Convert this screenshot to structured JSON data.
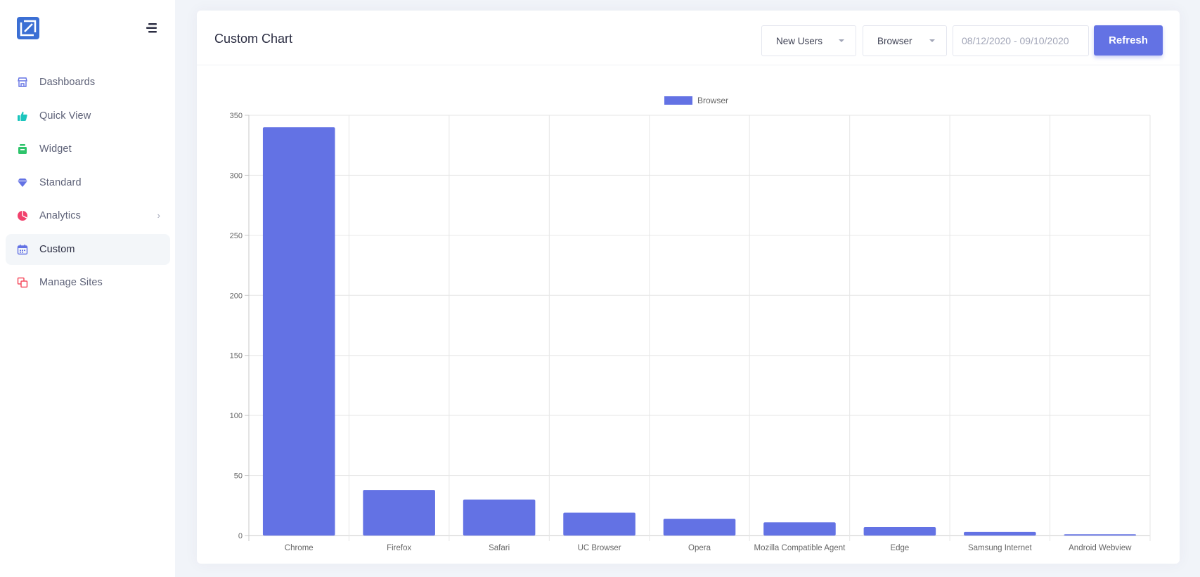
{
  "sidebar": {
    "items": [
      {
        "label": "Dashboards",
        "icon": "store-icon",
        "color": "#6372e4"
      },
      {
        "label": "Quick View",
        "icon": "thumb-icon",
        "color": "#1bc5bd"
      },
      {
        "label": "Widget",
        "icon": "box-icon",
        "color": "#2ec46b"
      },
      {
        "label": "Standard",
        "icon": "diamond-icon",
        "color": "#6372e4"
      },
      {
        "label": "Analytics",
        "icon": "pie-chart-icon",
        "color": "#f1416c",
        "has_submenu": true
      },
      {
        "label": "Custom",
        "icon": "calendar-icon",
        "color": "#6372e4",
        "active": true
      },
      {
        "label": "Manage Sites",
        "icon": "layers-icon",
        "color": "#f64e60"
      }
    ]
  },
  "card": {
    "title": "Custom Chart",
    "metric_select": "New Users",
    "dimension_select": "Browser",
    "date_range": "08/12/2020 - 09/10/2020",
    "refresh_label": "Refresh"
  },
  "chart_data": {
    "type": "bar",
    "categories": [
      "Chrome",
      "Firefox",
      "Safari",
      "UC Browser",
      "Opera",
      "Mozilla Compatible Agent",
      "Edge",
      "Samsung Internet",
      "Android Webview"
    ],
    "series": [
      {
        "name": "Browser",
        "values": [
          340,
          38,
          30,
          19,
          14,
          11,
          7,
          3,
          1
        ],
        "color": "#6372e4"
      }
    ],
    "ylim": [
      0,
      350
    ],
    "yticks": [
      0,
      50,
      100,
      150,
      200,
      250,
      300,
      350
    ],
    "grid": true,
    "legend": "top-center"
  }
}
